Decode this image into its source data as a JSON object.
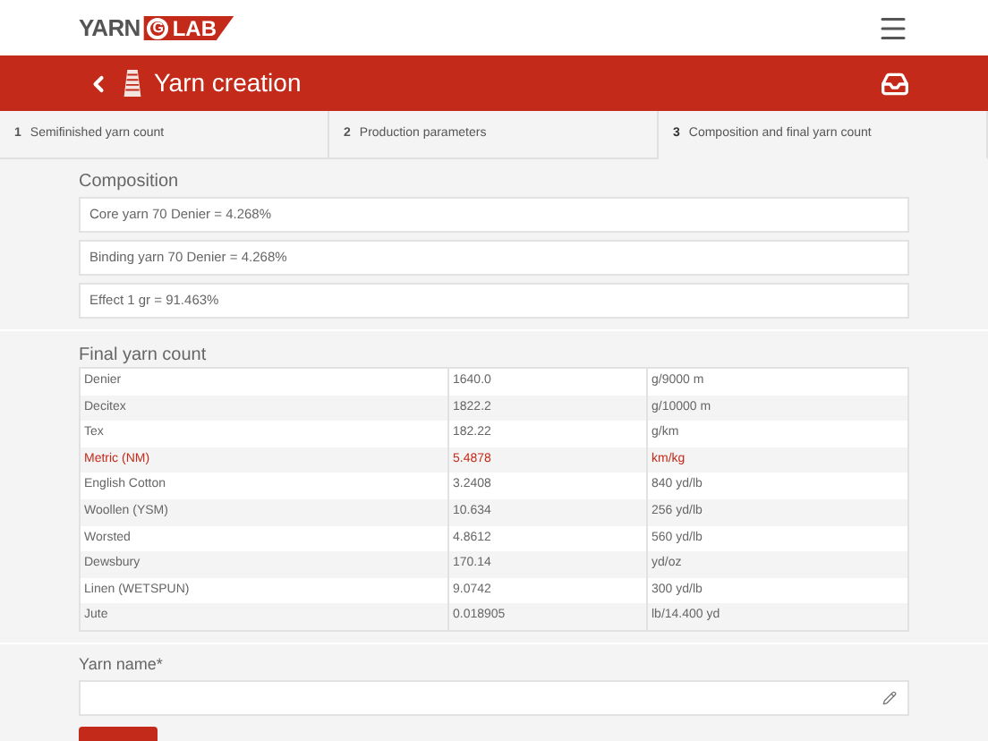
{
  "logo": {
    "left": "YARN",
    "middle": "G",
    "right": "LAB"
  },
  "title_bar": {
    "title": "Yarn creation"
  },
  "steps": [
    {
      "number": "1",
      "label": "Semifinished yarn count",
      "selected": false
    },
    {
      "number": "2",
      "label": "Production parameters",
      "selected": false
    },
    {
      "number": "3",
      "label": "Composition and final yarn count",
      "selected": true
    }
  ],
  "composition": {
    "heading": "Composition",
    "items": [
      "Core yarn 70 Denier = 4.268%",
      "Binding yarn 70 Denier = 4.268%",
      "Effect 1 gr = 91.463%"
    ]
  },
  "final_yarn_count": {
    "heading": "Final yarn count",
    "rows": [
      {
        "name": "Denier",
        "value": "1640.0",
        "unit": "g/9000 m",
        "highlighted": false
      },
      {
        "name": "Decitex",
        "value": "1822.2",
        "unit": "g/10000 m",
        "highlighted": false
      },
      {
        "name": "Tex",
        "value": "182.22",
        "unit": "g/km",
        "highlighted": false
      },
      {
        "name": "Metric (NM)",
        "value": "5.4878",
        "unit": "km/kg",
        "highlighted": true
      },
      {
        "name": "English Cotton",
        "value": "3.2408",
        "unit": "840 yd/lb",
        "highlighted": false
      },
      {
        "name": "Woollen (YSM)",
        "value": "10.634",
        "unit": "256 yd/lb",
        "highlighted": false
      },
      {
        "name": "Worsted",
        "value": "4.8612",
        "unit": "560 yd/lb",
        "highlighted": false
      },
      {
        "name": "Dewsbury",
        "value": "170.14",
        "unit": "yd/oz",
        "highlighted": false
      },
      {
        "name": "Linen (WETSPUN)",
        "value": "9.0742",
        "unit": "300 yd/lb",
        "highlighted": false
      },
      {
        "name": "Jute",
        "value": "0.018905",
        "unit": "lb/14.400 yd",
        "highlighted": false
      }
    ]
  },
  "yarn_name": {
    "label": "Yarn name*"
  }
}
